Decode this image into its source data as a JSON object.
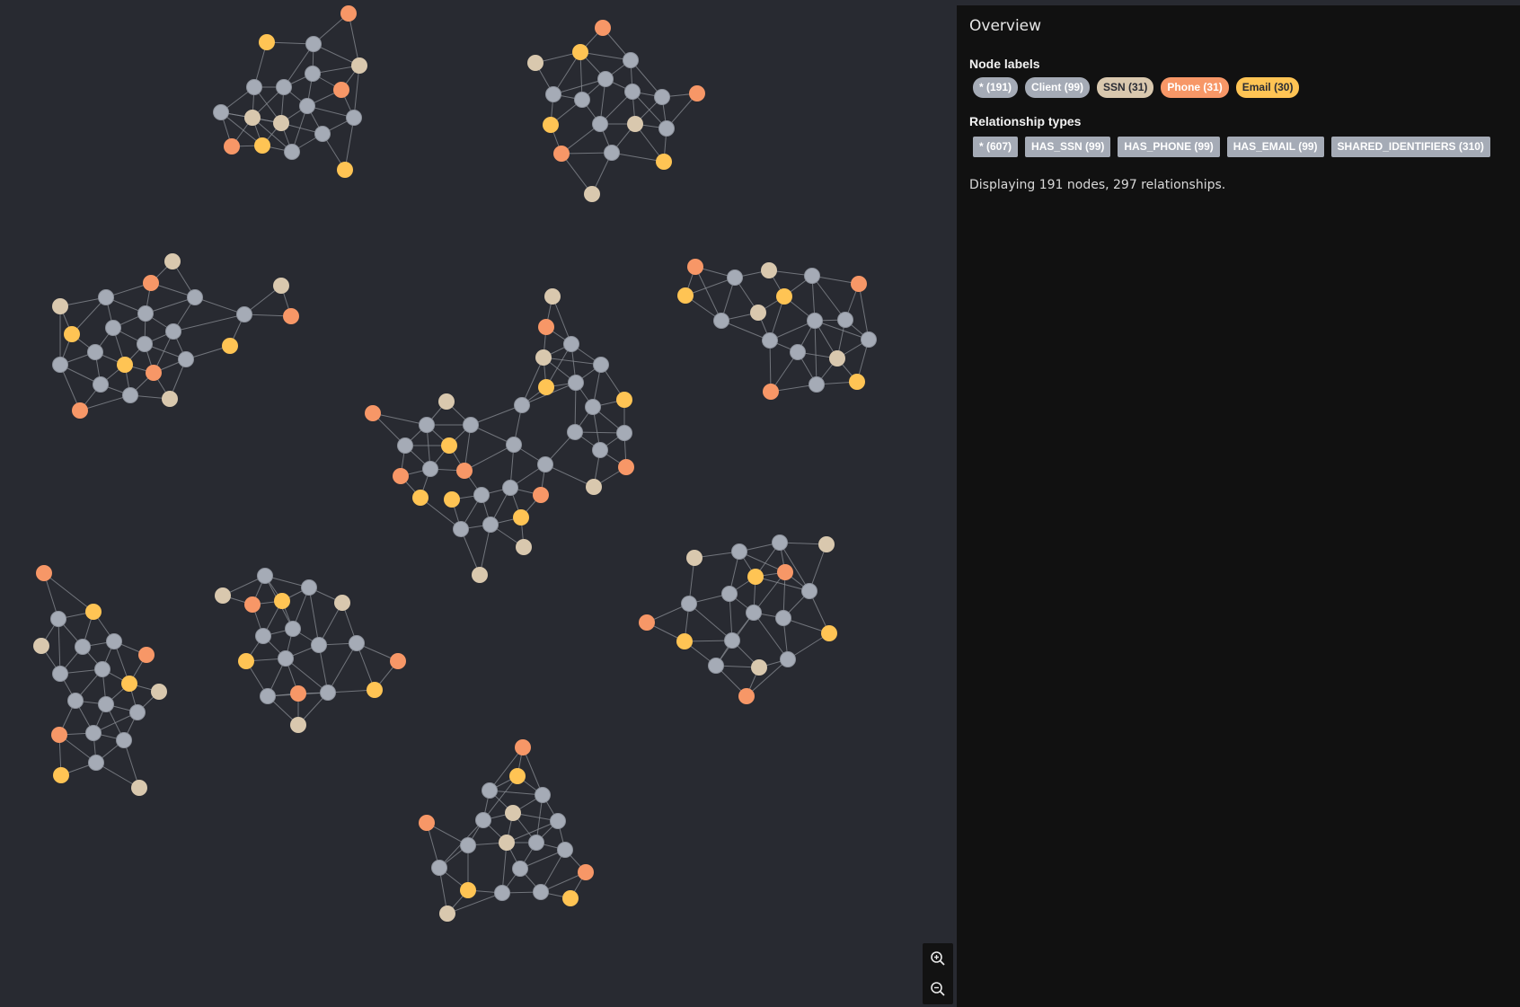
{
  "panel": {
    "title": "Overview",
    "node_labels_heading": "Node labels",
    "relationship_types_heading": "Relationship types",
    "node_labels": [
      {
        "text": "* (191)",
        "bg": "#a5abb6",
        "fg": "#ffffff"
      },
      {
        "text": "Client (99)",
        "bg": "#a5abb6",
        "fg": "#ffffff"
      },
      {
        "text": "SSN (31)",
        "bg": "#d9c8ae",
        "fg": "#2a2c34"
      },
      {
        "text": "Phone (31)",
        "bg": "#f79767",
        "fg": "#ffffff"
      },
      {
        "text": "Email (30)",
        "bg": "#ffc454",
        "fg": "#2a2c34"
      }
    ],
    "relationship_types": [
      {
        "text": "* (607)"
      },
      {
        "text": "HAS_SSN (99)"
      },
      {
        "text": "HAS_PHONE (99)"
      },
      {
        "text": "HAS_EMAIL (99)"
      },
      {
        "text": "SHARED_IDENTIFIERS (310)"
      }
    ],
    "summary": "Displaying 191 nodes, 297 relationships."
  },
  "colors": {
    "Client": "#a5abb6",
    "SSN": "#d9c8ae",
    "Phone": "#f79767",
    "Email": "#ffc454",
    "edge": "#8a8d94",
    "canvas": "#282a31",
    "panel": "#111111"
  },
  "zoom": {
    "in_icon": "zoom-in-icon",
    "out_icon": "zoom-out-icon"
  }
}
